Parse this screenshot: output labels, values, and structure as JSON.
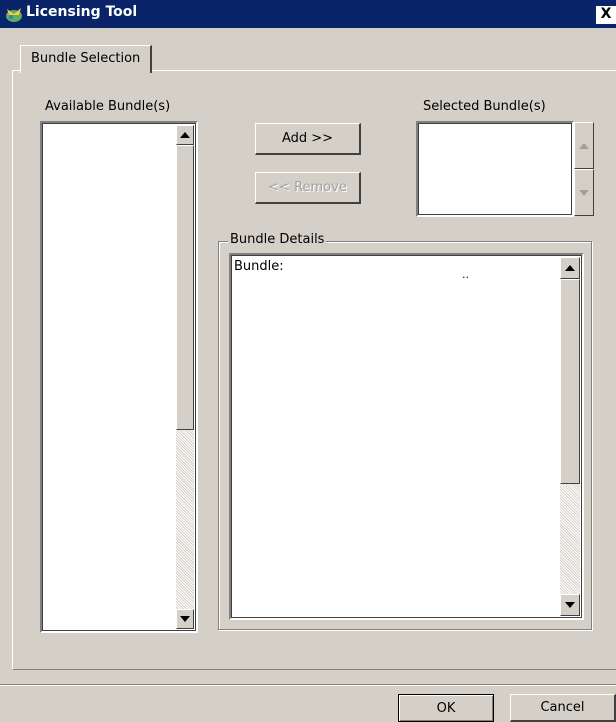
{
  "window": {
    "title": "Licensing Tool",
    "close_glyph": "X"
  },
  "tabs": [
    {
      "label": "Bundle Selection",
      "active": true
    }
  ],
  "available": {
    "label": "Available Bundle(s)",
    "items": []
  },
  "selected": {
    "label": "Selected Bundle(s)",
    "items": []
  },
  "buttons": {
    "add": "Add >>",
    "remove": "<< Remove",
    "ok": "OK",
    "cancel": "Cancel"
  },
  "details": {
    "group_label": "Bundle Details",
    "text_prefix": "Bundle:",
    "dots": ".."
  },
  "icons": {
    "title": "licensing-app-icon",
    "close": "close-icon",
    "scroll_up": "scroll-up-arrow-icon",
    "scroll_down": "scroll-down-arrow-icon"
  },
  "colors": {
    "titlebar": "#0a246a",
    "face": "#d4d0c8",
    "disabled_text": "#a0a0a0"
  }
}
